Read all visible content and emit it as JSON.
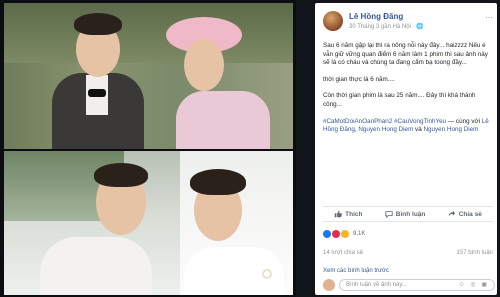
{
  "post": {
    "author": "Lê Hồng Đăng",
    "meta": "30 Tháng 3 gần Hà Nội · ",
    "paragraphs": [
      "Sau 6 năm gặp lại thì ra nông nỗi này đây... haizzzz Nếu e vẫn giữ vững quan điểm 6 năm làm 1 phim thì sau ảnh này sẽ là có cháu và chúng ta đang cẩm bạ toong đầy...",
      "thời gian thực là 6 năm....",
      "Còn thời gian phim là sau 25 năm.... Đây thì khá thành công..."
    ],
    "hashtags": "#CaMotDoiAnOanPhan2 #CauVongTinhYeu",
    "with_text": " — cùng với ",
    "tag1": "Lê Hồng Đăng",
    "tag_sep": ", ",
    "tag2": "Nguyen Hong Diem",
    "tag_and": " và ",
    "tag3": "Nguyen Hong Diem"
  },
  "actions": {
    "like": "Thích",
    "comment": "Bình luận",
    "share": "Chia sẻ"
  },
  "reactions": {
    "count": "9,1K",
    "colors": [
      "#1877f2",
      "#f02849",
      "#f7b125"
    ]
  },
  "stats": {
    "shares": "14 lượt chia sẻ",
    "comments": "157 bình luận",
    "more": "Xem các bình luận trước"
  },
  "comment_box": {
    "placeholder": "Bình luận về ảnh này...",
    "icons": "☺ ◎ ▣"
  }
}
